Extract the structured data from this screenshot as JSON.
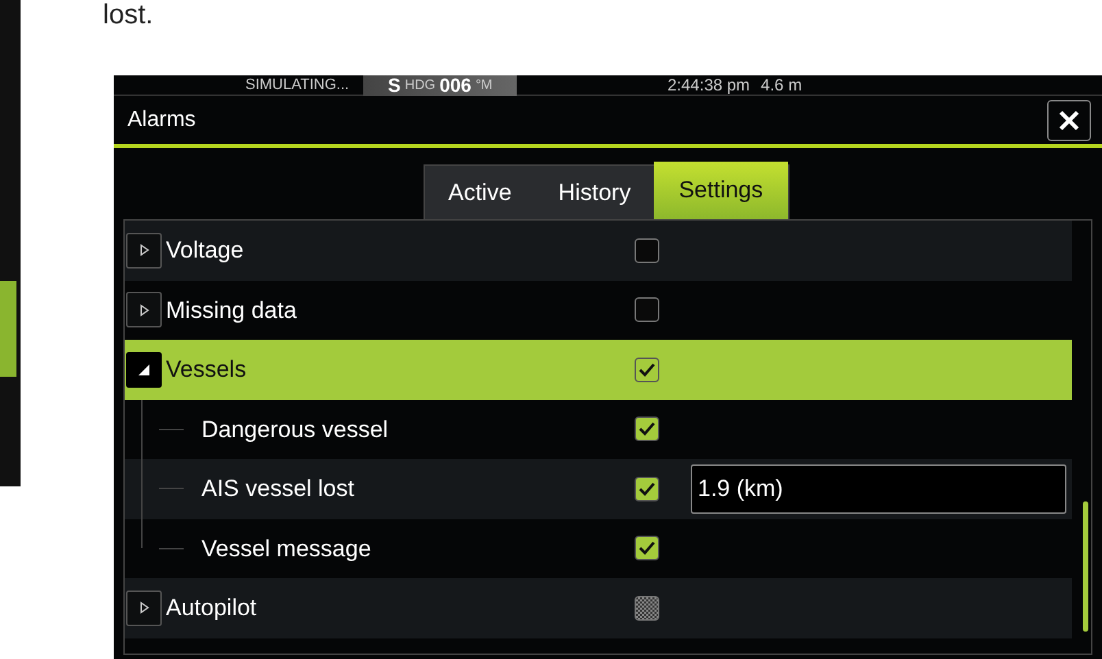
{
  "caption_fragment": "lost.",
  "status_bar": {
    "mode": "SIMULATING...",
    "heading": {
      "letter": "S",
      "label": "HDG",
      "value": "006",
      "unit": "°M"
    },
    "time": "2:44:38 pm",
    "depth": "4.6 m"
  },
  "window": {
    "title": "Alarms"
  },
  "tabs": [
    {
      "label": "Active",
      "selected": false
    },
    {
      "label": "History",
      "selected": false
    },
    {
      "label": "Settings",
      "selected": true
    }
  ],
  "alarms": [
    {
      "name": "Voltage",
      "expanded": false,
      "selected": false,
      "enabled": false
    },
    {
      "name": "Missing data",
      "expanded": false,
      "selected": false,
      "enabled": false
    },
    {
      "name": "Vessels",
      "expanded": true,
      "selected": true,
      "enabled": true,
      "children": [
        {
          "name": "Dangerous vessel",
          "enabled": true
        },
        {
          "name": "AIS vessel lost",
          "enabled": true,
          "value": "1.9 (km)"
        },
        {
          "name": "Vessel message",
          "enabled": true
        }
      ]
    },
    {
      "name": "Autopilot",
      "expanded": false,
      "selected": false,
      "enabled": false,
      "partial": true
    }
  ]
}
